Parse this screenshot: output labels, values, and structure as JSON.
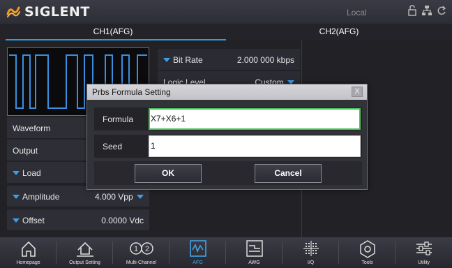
{
  "brand": {
    "name": "SIGLENT",
    "logo_color": "#f29b21"
  },
  "status": {
    "mode": "Local",
    "icons": [
      "unlock-icon",
      "network-icon",
      "refresh-icon"
    ]
  },
  "tabs": [
    {
      "label": "CH1(AFG)",
      "active": true
    },
    {
      "label": "CH2(AFG)",
      "active": false
    }
  ],
  "params": {
    "waveform": {
      "label": "Waveform"
    },
    "output": {
      "label": "Output"
    },
    "load": {
      "label": "Load"
    },
    "amplitude": {
      "label": "Amplitude",
      "value": "4.000 Vpp"
    },
    "offset": {
      "label": "Offset",
      "value": "0.0000 Vdc"
    }
  },
  "right_params": {
    "bit_rate": {
      "label": "Bit Rate",
      "value": "2.000 000  kbps"
    },
    "logic_level": {
      "label": "Logic Level",
      "value": "Custom"
    }
  },
  "dialog": {
    "title": "Prbs Formula Setting",
    "close_label": "X",
    "formula_label": "Formula",
    "formula_value": "X7+X6+1",
    "seed_label": "Seed",
    "seed_value": "1",
    "ok_label": "OK",
    "cancel_label": "Cancel"
  },
  "nav": [
    {
      "label": "Homepage",
      "icon": "home-icon",
      "active": false
    },
    {
      "label": "Output Setting",
      "icon": "output-setting-icon",
      "active": false
    },
    {
      "label": "Multi-Channel",
      "icon": "multi-channel-icon",
      "active": false
    },
    {
      "label": "AFG",
      "icon": "afg-wave-icon",
      "active": true
    },
    {
      "label": "AWG",
      "icon": "awg-icon",
      "active": false
    },
    {
      "label": "I/Q",
      "icon": "iq-icon",
      "active": false
    },
    {
      "label": "Tools",
      "icon": "tools-icon",
      "active": false
    },
    {
      "label": "Utility",
      "icon": "utility-icon",
      "active": false
    }
  ],
  "colors": {
    "accent": "#2f9be6",
    "focus": "#4cc25a",
    "waveform": "#3a8fe0"
  }
}
